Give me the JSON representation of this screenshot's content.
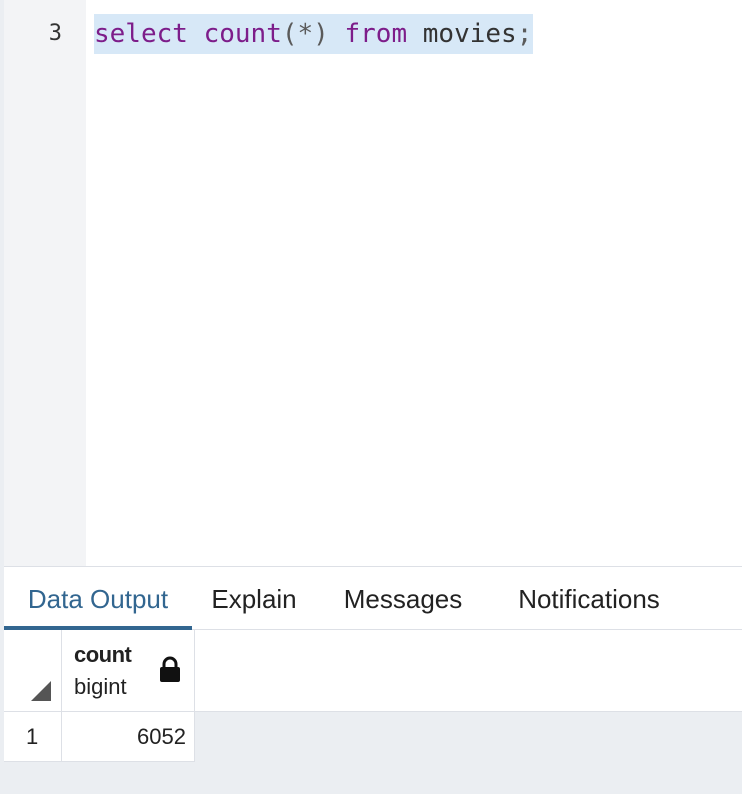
{
  "editor": {
    "line_number": "3",
    "code": {
      "kw_select": "select",
      "fn_count": "count",
      "punct_open": "(*)",
      "kw_from": "from",
      "ident_table": "movies",
      "punct_end": ";"
    }
  },
  "tabs": [
    {
      "label": "Data Output",
      "active": true
    },
    {
      "label": "Explain",
      "active": false
    },
    {
      "label": "Messages",
      "active": false
    },
    {
      "label": "Notifications",
      "active": false
    }
  ],
  "grid": {
    "columns": [
      {
        "name": "count",
        "type": "bigint",
        "icon": "lock-icon"
      }
    ],
    "rows": [
      {
        "row_number": "1",
        "values": [
          "6052"
        ]
      }
    ]
  },
  "colors": {
    "accent": "#326690",
    "keyword": "#7d1d8a",
    "selection": "#d7e8f7"
  }
}
